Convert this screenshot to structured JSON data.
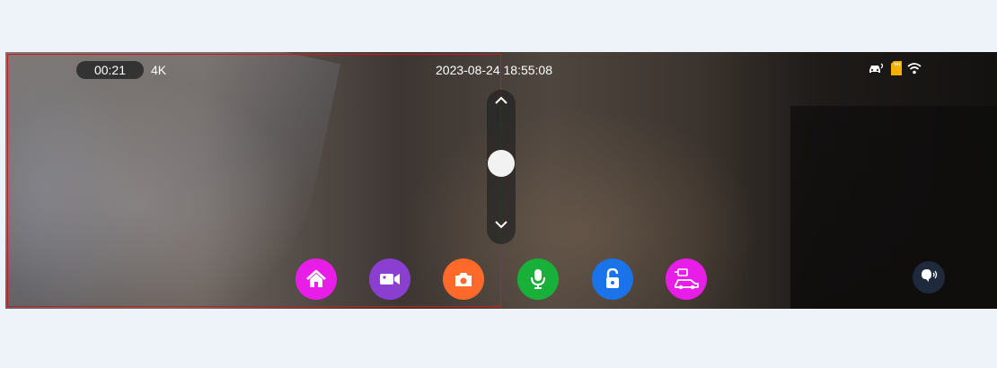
{
  "status": {
    "recording_time": "00:21",
    "resolution": "4K",
    "datetime": "2023-08-24 18:55:08",
    "icons": [
      "car-connect-icon",
      "sd-card-icon",
      "wifi-icon"
    ],
    "sd_card_color": "#f5b000"
  },
  "zoom": {
    "level": 0.55,
    "up_icon": "chevron-up-icon",
    "down_icon": "chevron-down-icon"
  },
  "toolbar": {
    "buttons": [
      {
        "name": "home-button",
        "icon": "home-icon",
        "color": "#e81ee8"
      },
      {
        "name": "record-video-button",
        "icon": "video-camera-icon",
        "color": "#8a3fd0"
      },
      {
        "name": "take-photo-button",
        "icon": "camera-icon",
        "color": "#ff6a2a"
      },
      {
        "name": "microphone-button",
        "icon": "microphone-icon",
        "color": "#19b03a"
      },
      {
        "name": "lock-file-button",
        "icon": "unlock-icon",
        "color": "#1a73e8"
      },
      {
        "name": "parking-monitor-button",
        "icon": "car-monitor-icon",
        "color": "#e81ee8"
      }
    ],
    "voice_control_icon": "voice-speech-icon"
  }
}
